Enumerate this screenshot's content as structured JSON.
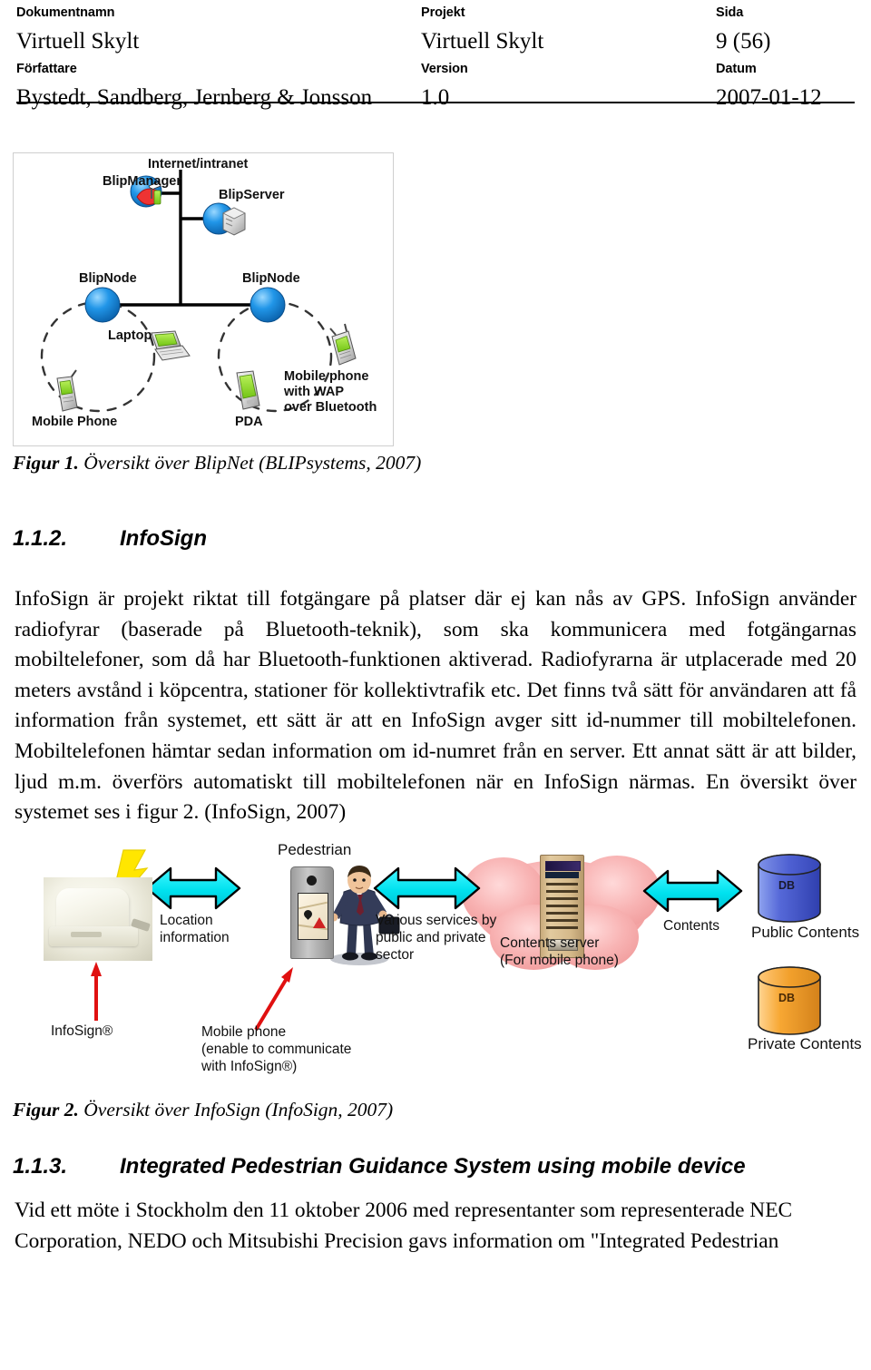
{
  "header": {
    "labels": {
      "dokumentnamn": "Dokumentnamn",
      "projekt": "Projekt",
      "sida": "Sida",
      "forfattare": "Författare",
      "version": "Version",
      "datum": "Datum"
    },
    "values": {
      "dokumentnamn": "Virtuell Skylt",
      "projekt": "Virtuell Skylt",
      "sida": "9 (56)",
      "forfattare": "Bystedt, Sandberg, Jernberg & Jonsson",
      "version": "1.0",
      "datum": "2007-01-12"
    }
  },
  "figure1": {
    "caption_bold": "Figur 1.",
    "caption_rest": " Översikt över BlipNet (BLIPsystems, 2007)",
    "labels": {
      "internet": "Internet/intranet",
      "blipmanager": "BlipManager",
      "blipserver": "BlipServer",
      "blipnode_left": "BlipNode",
      "blipnode_right": "BlipNode",
      "laptop": "Laptop",
      "mobile_phone": "Mobile Phone",
      "pda": "PDA",
      "mobile_wap": "Mobile phone\nwith WAP\nover Bluetooth"
    },
    "colors": {
      "node_blue": "#1E90E8",
      "manager_red": "#E52D2D",
      "screen_green": "#8CE02B",
      "device_gray": "#D8D8D8",
      "line": "#000000",
      "border": "#cfcfcf"
    }
  },
  "section_112": {
    "number": "1.1.2.",
    "title": "InfoSign"
  },
  "paragraph_infosign": "InfoSign är projekt riktat till fotgängare på platser där ej kan nås av GPS. InfoSign använder radiofyrar (baserade på Bluetooth-teknik), som ska kommunicera med fotgängarnas mobiltelefoner, som då har Bluetooth-funktionen aktiverad. Radiofyrarna är utplacerade med 20 meters avstånd i köpcentra, stationer för kollektivtrafik etc. Det finns två sätt för användaren att få information från systemet, ett sätt är att en InfoSign avger sitt id-nummer till mobiltelefonen. Mobiltelefonen hämtar sedan information om id-numret från en server. Ett annat sätt är att bilder, ljud m.m. överförs automatiskt till mobiltelefonen när en InfoSign närmas. En översikt över systemet ses i figur 2. (InfoSign, 2007)",
  "figure2": {
    "caption_bold": "Figur 2.",
    "caption_rest": " Översikt över InfoSign (InfoSign, 2007)",
    "labels": {
      "infosign": "InfoSign®",
      "location_information": "Location\ninformation",
      "pedestrian": "Pedestrian",
      "mobile_phone": "Mobile phone\n(enable to communicate\nwith InfoSign®)",
      "various_services": "Various services by\npublic and private\nsector",
      "contents_server": "Contents server\n(For mobile phone)",
      "contents": "Contents",
      "public_contents": "Public Contents",
      "private_contents": "Private Contents",
      "db_public": "DB",
      "db_private": "DB"
    },
    "colors": {
      "arrow_fill": "#00E8F0",
      "arrow_stroke": "#000000",
      "cloud_pink": "#F7AFAF",
      "server_tan": "#D9BE8D",
      "db_blue": "#5B74D4",
      "db_orange": "#F5A62E",
      "red_arrow": "#E01010",
      "lightning_yellow": "#FFE600",
      "suit_navy": "#2E3650"
    }
  },
  "section_113": {
    "number": "1.1.3.",
    "title": "Integrated Pedestrian Guidance System using mobile device"
  },
  "paragraph_ipgs": "Vid ett möte i Stockholm den 11 oktober 2006 med representanter som representerade NEC Corporation, NEDO och Mitsubishi Precision gavs information om \"Integrated Pedestrian"
}
